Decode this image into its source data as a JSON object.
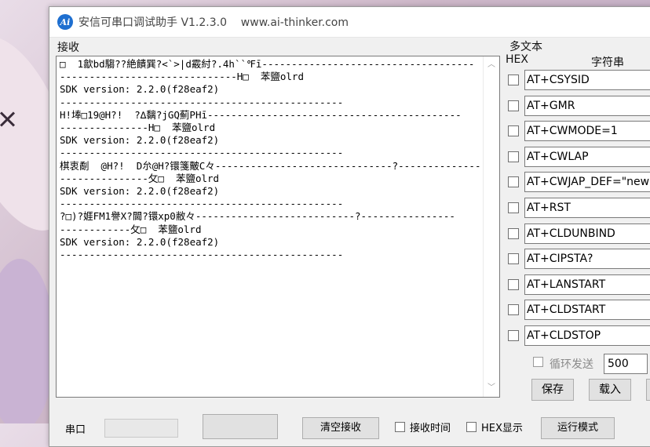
{
  "window": {
    "icon_text": "Ai",
    "title": "安信可串口调试助手 V1.2.3.0    www.ai-thinker.com"
  },
  "receive": {
    "label": "接收",
    "lines": [
      "□  1歙bd騶??絶饋巽?<`>|d霰紂?.4h``℉ī------------------------------------",
      "------------------------------H□  苯鹽olrd",
      "SDK version: 2.2.0(f28eaf2)",
      "------------------------------------------------",
      "H!埲□19@H?!  ?∆黐?jGQ薊PHī-------------------------------------------",
      "---------------H□  苯鹽olrd",
      "SDK version: 2.2.0(f28eaf2)",
      "------------------------------------------------",
      "棋衷劀  @H?!  D厼@H?镮箋皾C々------------------------------?-----------------",
      "---------------攵□  苯鹽olrd",
      "SDK version: 2.2.0(f28eaf2)",
      "------------------------------------------------",
      "?□)?娾FM1譽X?閫?镮xp0敝々---------------------------?----------------",
      "------------攵□  苯鹽olrd",
      "SDK version: 2.2.0(f28eaf2)",
      "------------------------------------------------"
    ]
  },
  "multi_text": {
    "title": "多文本",
    "hex_header": "HEX",
    "string_header": "字符串",
    "commands": [
      "AT+CSYSID",
      "AT+GMR",
      "AT+CWMODE=1",
      "AT+CWLAP",
      "AT+CWJAP_DEF=\"newifi_",
      "AT+RST",
      "AT+CLDUNBIND",
      "AT+CIPSTA?",
      "AT+LANSTART",
      "AT+CLDSTART",
      "AT+CLDSTOP"
    ],
    "loop_send_label": "循环发送",
    "interval_value": "500",
    "save_label": "保存",
    "load_label": "载入"
  },
  "bottom": {
    "port_label": "串口",
    "clear_label": "清空接收",
    "timestamp_label": "接收时间",
    "hex_display_label": "HEX显示",
    "mode_label": "运行模式"
  }
}
